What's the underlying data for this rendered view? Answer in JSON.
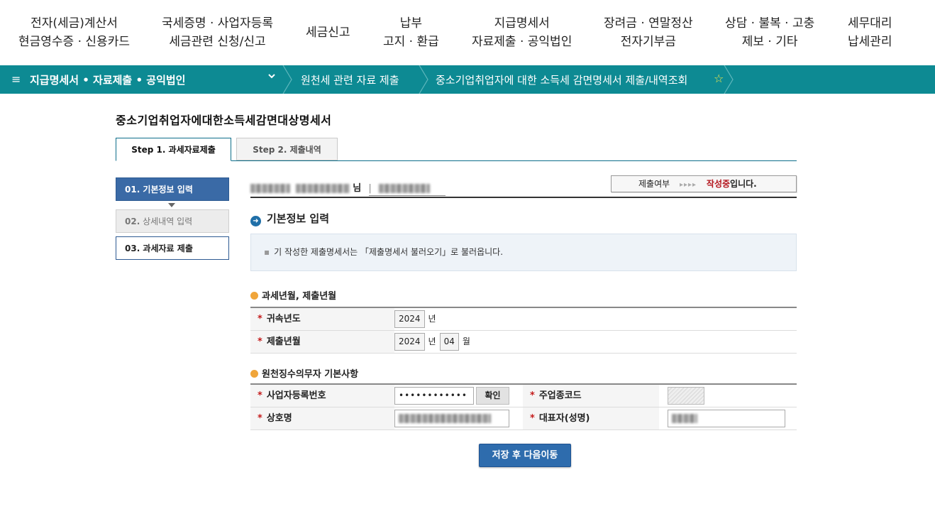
{
  "topnav": {
    "items": [
      {
        "line1": "전자(세금)계산서",
        "line2": "현금영수증 · 신용카드"
      },
      {
        "line1": "국세증명 · 사업자등록",
        "line2": "세금관련 신청/신고"
      },
      {
        "line1": "세금신고",
        "line2": ""
      },
      {
        "line1": "납부",
        "line2": "고지 · 환급"
      },
      {
        "line1": "지급명세서",
        "line2": "자료제출 · 공익법인"
      },
      {
        "line1": "장려금 · 연말정산",
        "line2": "전자기부금"
      },
      {
        "line1": "상담 · 불복 · 고충",
        "line2": "제보 · 기타"
      },
      {
        "line1": "세무대리",
        "line2": "납세관리"
      }
    ]
  },
  "breadcrumb": {
    "menu_icon": "≡",
    "level1": "지급명세서 • 자료제출 • 공익법인",
    "level2": "원천세 관련 자료 제출",
    "level3": "중소기업취업자에 대한 소득세 감면명세서 제출/내역조회",
    "star_icon": "☆"
  },
  "page": {
    "title": "중소기업취업자에대한소득세감면대상명세서"
  },
  "tabs": [
    {
      "label": "Step 1. 과세자료제출"
    },
    {
      "label": "Step 2. 제출내역"
    }
  ],
  "steps": [
    {
      "label": "01. 기본정보 입력"
    },
    {
      "num": "02.",
      "label": "상세내역 입력"
    },
    {
      "label": "03. 과세자료 제출"
    }
  ],
  "user": {
    "suffix": "님",
    "divider": "|"
  },
  "status": {
    "label": "제출여부",
    "arrows": "▸▸▸▸",
    "state": "작성중",
    "suffix": "입니다."
  },
  "section": {
    "title": "기본정보 입력",
    "info": "기 작성한 제출명세서는 「제출명세서 불러오기」로 불러옵니다.",
    "info_dot": "▪"
  },
  "subsection1": {
    "title": "과세년월, 제출년월",
    "rows": [
      {
        "label": "귀속년도",
        "year": "2024",
        "year_unit": "년"
      },
      {
        "label": "제출년월",
        "year": "2024",
        "year_unit": "년",
        "month": "04",
        "month_unit": "월"
      }
    ]
  },
  "subsection2": {
    "title": "원천징수의무자 기본사항",
    "brn_label": "사업자등록번호",
    "brn_value": "••••••••••••",
    "confirm_label": "확인",
    "industry_label": "주업종코드",
    "company_label": "상호명",
    "rep_label": "대표자(성명)"
  },
  "required_mark": "*",
  "save_button": "저장 후 다음이동"
}
